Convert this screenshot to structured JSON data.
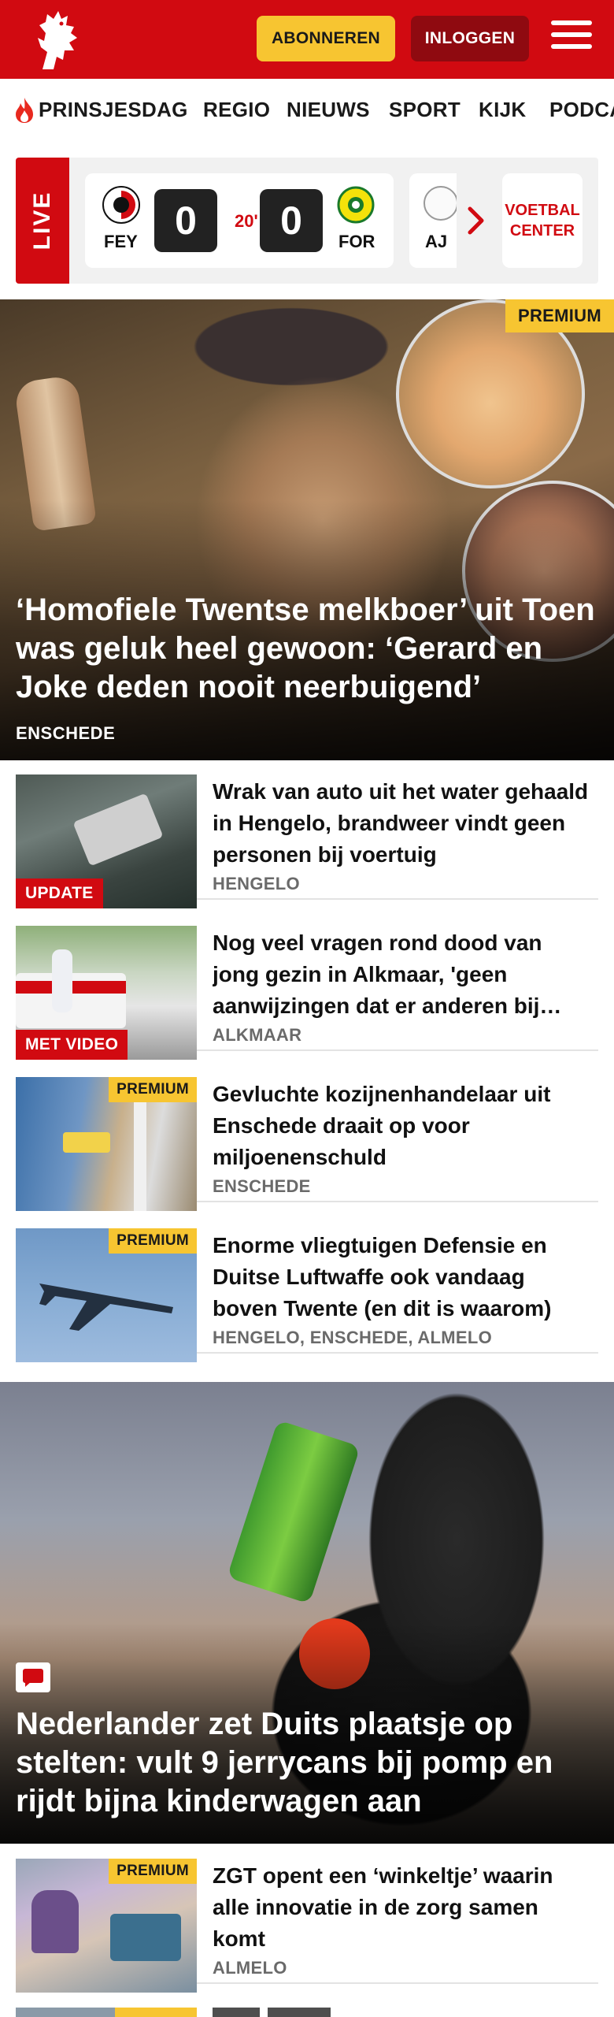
{
  "header": {
    "logo_alt": "Tubantia horse logo",
    "subscribe_label": "ABONNEREN",
    "login_label": "INLOGGEN",
    "colors": {
      "brand_red": "#d10a11",
      "subscribe_yellow": "#f7c531",
      "login_dark_red": "#8f0a10"
    }
  },
  "nav": {
    "items": [
      {
        "label": "PRINSJESDAG",
        "icon": "flame-icon"
      },
      {
        "label": "REGIO"
      },
      {
        "label": "NIEUWS"
      },
      {
        "label": "SPORT"
      },
      {
        "label": "KIJK"
      },
      {
        "label": "PODCA"
      }
    ]
  },
  "live": {
    "badge": "LIVE",
    "match": {
      "home_abbr": "FEY",
      "home_score": "0",
      "minute": "20'",
      "away_score": "0",
      "away_abbr": "FOR"
    },
    "next_match_abbr": "AJ",
    "voetbal_center_line1": "VOETBAL",
    "voetbal_center_line2": "CENTER"
  },
  "hero": {
    "badge": "PREMIUM",
    "title": "‘Homofiele Twentse melkboer’ uit Toen was geluk heel gewoon: ‘Gerard en Joke deden nooit neerbuigend’",
    "location": "ENSCHEDE"
  },
  "articles": [
    {
      "title": "Wrak van auto uit het water gehaald in Hengelo, brandweer vindt geen personen bij voertuig",
      "location": "HENGELO",
      "tag": "UPDATE",
      "tag_type": "red"
    },
    {
      "title": "Nog veel vragen rond dood van jong gezin in Alkmaar, 'geen aanwijzingen dat er anderen bij…",
      "location": "ALKMAAR",
      "tag": "MET VIDEO",
      "tag_type": "red"
    },
    {
      "title": "Gevluchte kozijnenhandelaar uit Enschede draait op voor miljoenenschuld",
      "location": "ENSCHEDE",
      "tag": "PREMIUM",
      "tag_type": "premium"
    },
    {
      "title": "Enorme vliegtuigen Defensie en Duitse Luftwaffe ook vandaag boven Twente (en dit is waarom)",
      "location": "HENGELO, ENSCHEDE, ALMELO",
      "tag": "PREMIUM",
      "tag_type": "premium"
    }
  ],
  "hero2": {
    "title": "Nederlander zet Duits plaatsje op stelten: vult 9 jerrycans bij pomp en rijdt bijna kinderwagen aan",
    "icon": "comment-icon"
  },
  "articles2": [
    {
      "title": "ZGT opent een ‘winkeltje’ waarin alle innovatie in de zorg samen komt",
      "location": "ALMELO",
      "tag": "PREMIUM",
      "tag_type": "premium"
    }
  ]
}
